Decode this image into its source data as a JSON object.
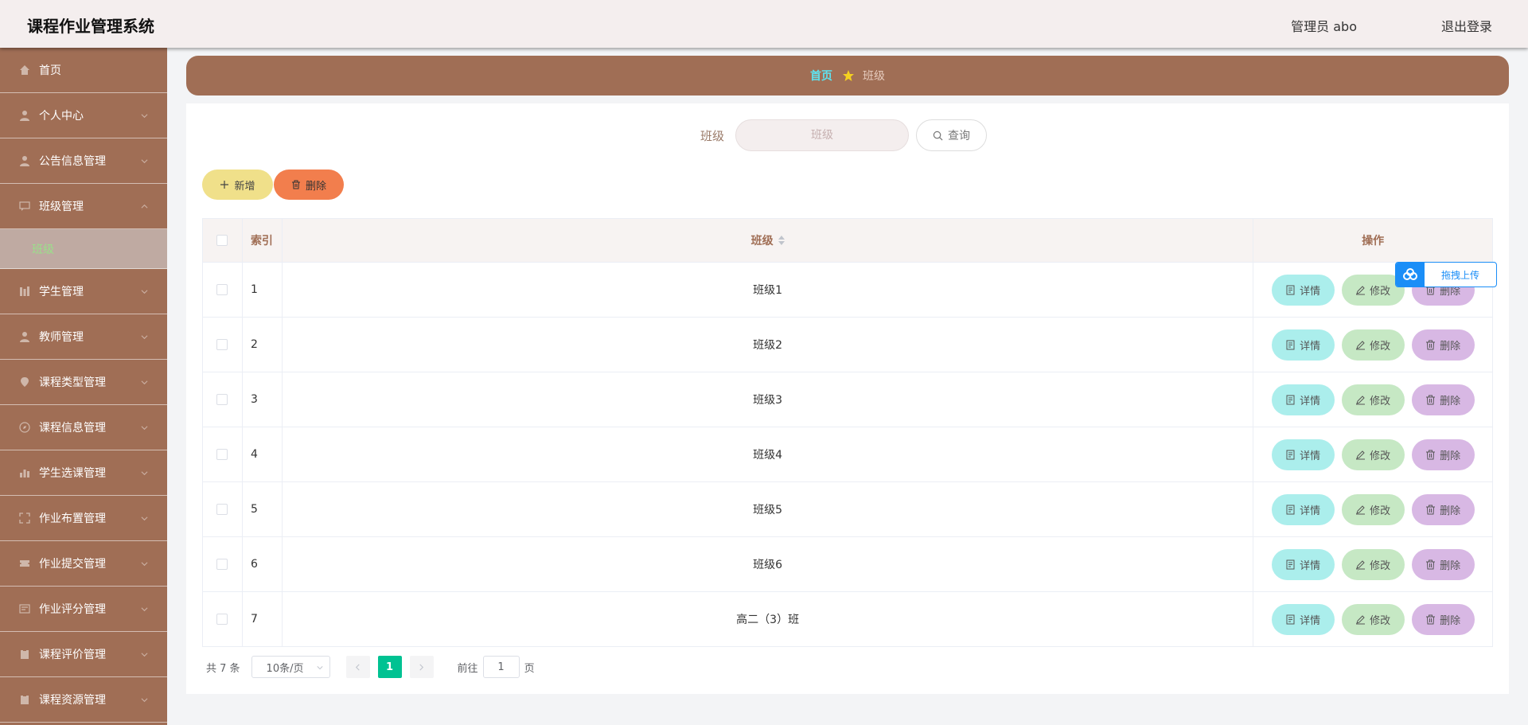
{
  "header": {
    "app_title": "课程作业管理系统",
    "user_info": "管理员 abo",
    "logout": "退出登录"
  },
  "sidebar": {
    "items": [
      {
        "label": "首页",
        "icon": "home-icon"
      },
      {
        "label": "个人中心",
        "icon": "user-icon"
      },
      {
        "label": "公告信息管理",
        "icon": "user-icon"
      },
      {
        "label": "班级管理",
        "icon": "message-icon",
        "expanded": true
      },
      {
        "label": "学生管理",
        "icon": "grid-icon"
      },
      {
        "label": "教师管理",
        "icon": "user-icon"
      },
      {
        "label": "课程类型管理",
        "icon": "location-icon"
      },
      {
        "label": "课程信息管理",
        "icon": "compass-icon"
      },
      {
        "label": "学生选课管理",
        "icon": "chart-icon"
      },
      {
        "label": "作业布置管理",
        "icon": "fullscreen-icon"
      },
      {
        "label": "作业提交管理",
        "icon": "ticket-icon"
      },
      {
        "label": "作业评分管理",
        "icon": "document-icon"
      },
      {
        "label": "课程评价管理",
        "icon": "clipboard-icon"
      },
      {
        "label": "课程资源管理",
        "icon": "clipboard-icon"
      }
    ],
    "sub_item": "班级"
  },
  "breadcrumb": {
    "home": "首页",
    "current": "班级"
  },
  "search": {
    "label": "班级",
    "placeholder": "班级",
    "query_button": "查询"
  },
  "toolbar": {
    "add_label": "新增",
    "delete_label": "删除"
  },
  "table": {
    "headers": {
      "index": "索引",
      "class": "班级",
      "ops": "操作"
    },
    "rows": [
      {
        "index": "1",
        "class": "班级1"
      },
      {
        "index": "2",
        "class": "班级2"
      },
      {
        "index": "3",
        "class": "班级3"
      },
      {
        "index": "4",
        "class": "班级4"
      },
      {
        "index": "5",
        "class": "班级5"
      },
      {
        "index": "6",
        "class": "班级6"
      },
      {
        "index": "7",
        "class": "高二（3）班"
      }
    ],
    "actions": {
      "detail": "详情",
      "edit": "修改",
      "delete": "删除"
    }
  },
  "pagination": {
    "total": "共 7 条",
    "page_size": "10条/页",
    "current_page": "1",
    "goto_prefix": "前往",
    "goto_value": "1",
    "goto_suffix": "页"
  },
  "upload_widget": {
    "label": "拖拽上传"
  },
  "colors": {
    "accent": "#a06e55",
    "pager_active": "#00c292",
    "detail_btn": "#abeeec",
    "edit_btn": "#c6e8c4",
    "delete_btn": "#d8b8e4",
    "add_btn": "#f0e08a",
    "bulk_delete_btn": "#f27e4d"
  }
}
